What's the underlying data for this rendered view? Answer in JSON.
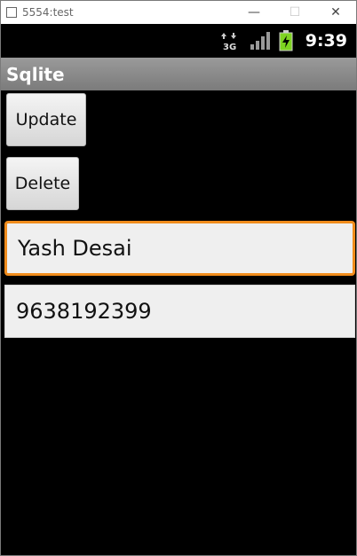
{
  "window": {
    "title": "5554:test",
    "minimize_glyph": "—",
    "maximize_glyph": "☐",
    "close_glyph": "✕"
  },
  "statusbar": {
    "network_label": "3G",
    "clock": "9:39",
    "colors": {
      "battery": "#7ed321",
      "signal": "#9a9a9a"
    }
  },
  "appbar": {
    "title": "Sqlite"
  },
  "buttons": {
    "update_label": "Update",
    "delete_label": "Delete"
  },
  "fields": {
    "name_value": "Yash Desai",
    "phone_value": "9638192399"
  },
  "colors": {
    "focus_border": "#f08c1c",
    "appbar": "#8a8a8a"
  }
}
